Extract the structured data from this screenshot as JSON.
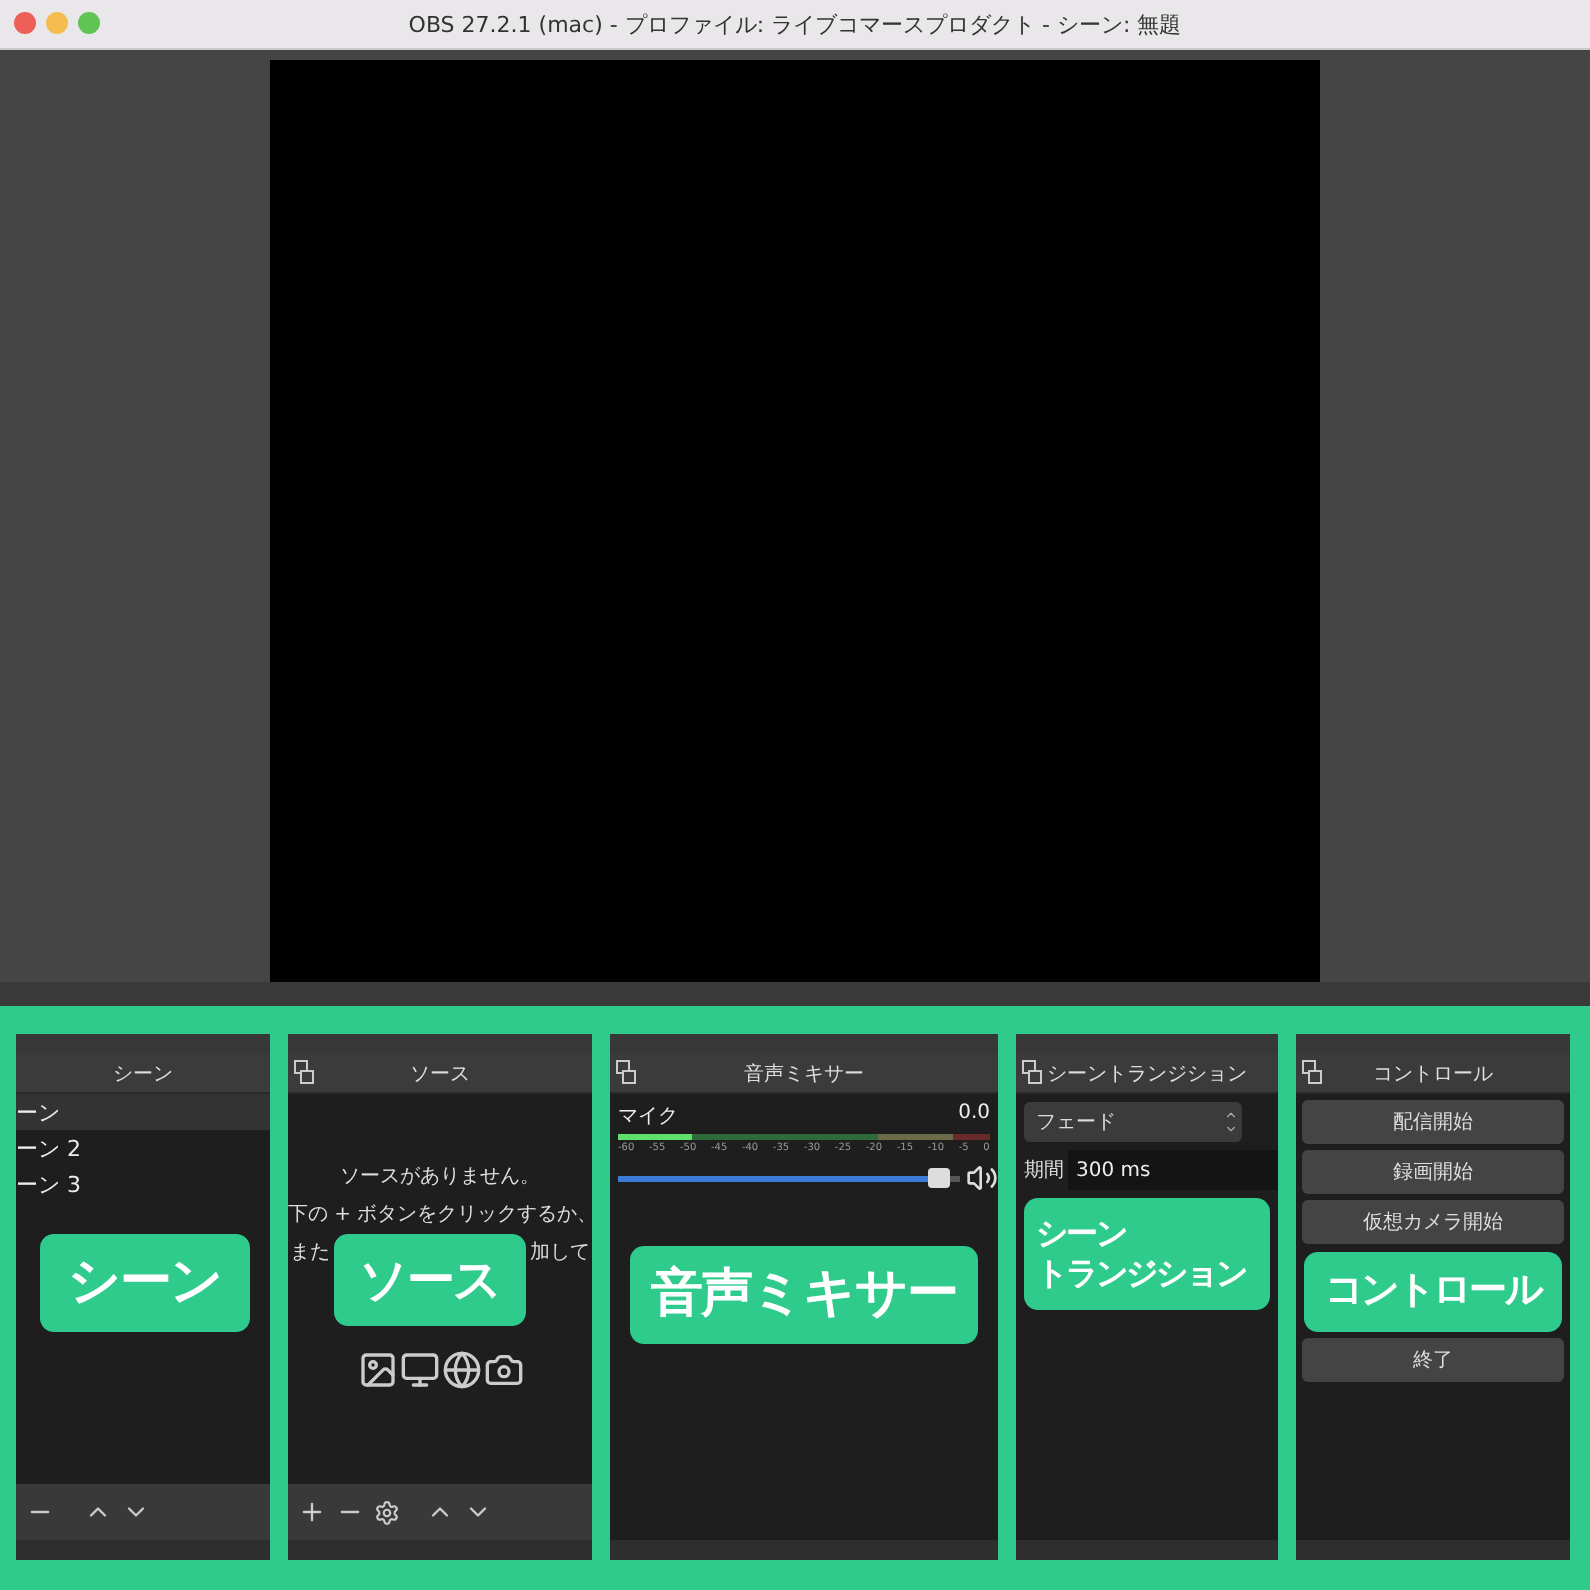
{
  "window": {
    "title": "OBS 27.2.1 (mac) - プロファイル: ライブコマースプロダクト - シーン: 無題"
  },
  "scenes": {
    "title": "シーン",
    "items": [
      {
        "label": "ーン",
        "selected": true
      },
      {
        "label": "ーン 2",
        "selected": false
      },
      {
        "label": "ーン 3",
        "selected": false
      }
    ],
    "annotation": [
      "シーン"
    ]
  },
  "sources": {
    "title": "ソース",
    "message": [
      "ソースがありません。",
      "下の + ボタンをクリックするか、"
    ],
    "message_fragments": [
      "また",
      "加して"
    ],
    "annotation": [
      "ソース"
    ]
  },
  "mixer": {
    "title": "音声ミキサー",
    "channel": {
      "name": "マイク",
      "reading": "0.0",
      "level": 0.97,
      "muted": false
    },
    "meter": {
      "level": 0.2
    },
    "ticks": [
      "-60",
      "-55",
      "-50",
      "-45",
      "-40",
      "-35",
      "-30",
      "-25",
      "-20",
      "-15",
      "-10",
      "-5",
      "0"
    ],
    "annotation": [
      "音声ミキサー"
    ]
  },
  "transitions": {
    "title": "シーントランジション",
    "transition": "フェード",
    "duration_label": "期間",
    "duration": "300 ms",
    "annotation": [
      "シーン",
      "トランジション"
    ]
  },
  "controls": {
    "title": "コントロール",
    "buttons": [
      "配信開始",
      "録画開始",
      "仮想カメラ開始"
    ],
    "annotation": [
      "コントロール"
    ],
    "last_button": "終了"
  }
}
